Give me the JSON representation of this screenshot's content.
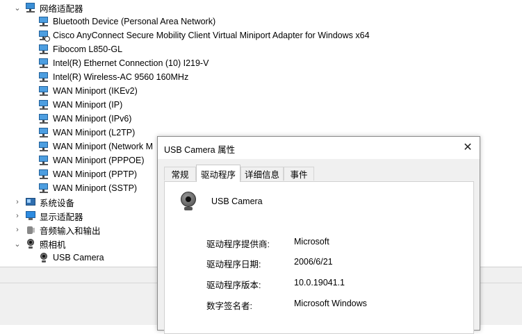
{
  "tree": {
    "categories": [
      {
        "label": "网络适配器",
        "expanded": true,
        "icon": "network-adapter-icon"
      },
      {
        "label": "系统设备",
        "expanded": false,
        "icon": "system-device-icon"
      },
      {
        "label": "显示适配器",
        "expanded": false,
        "icon": "display-adapter-icon"
      },
      {
        "label": "音频输入和输出",
        "expanded": false,
        "icon": "audio-icon"
      },
      {
        "label": "照相机",
        "expanded": true,
        "icon": "camera-icon"
      }
    ],
    "network_items": [
      "Bluetooth Device (Personal Area Network)",
      "Cisco AnyConnect Secure Mobility Client Virtual Miniport Adapter for Windows x64",
      "Fibocom L850-GL",
      "Intel(R) Ethernet Connection (10) I219-V",
      "Intel(R) Wireless-AC 9560 160MHz",
      "WAN Miniport (IKEv2)",
      "WAN Miniport (IP)",
      "WAN Miniport (IPv6)",
      "WAN Miniport (L2TP)",
      "WAN Miniport (Network M",
      "WAN Miniport (PPPOE)",
      "WAN Miniport (PPTP)",
      "WAN Miniport (SSTP)"
    ],
    "camera_items": [
      "USB Camera"
    ]
  },
  "dialog": {
    "title": "USB Camera 属性",
    "close_glyph": "✕",
    "tabs": [
      "常规",
      "驱动程序",
      "详细信息",
      "事件"
    ],
    "active_tab": "驱动程序",
    "device_name": "USB Camera",
    "properties": [
      {
        "key": "驱动程序提供商:",
        "value": "Microsoft"
      },
      {
        "key": "驱动程序日期:",
        "value": "2006/6/21"
      },
      {
        "key": "驱动程序版本:",
        "value": "10.0.19041.1"
      },
      {
        "key": "数字签名者:",
        "value": "Microsoft Windows"
      }
    ]
  }
}
